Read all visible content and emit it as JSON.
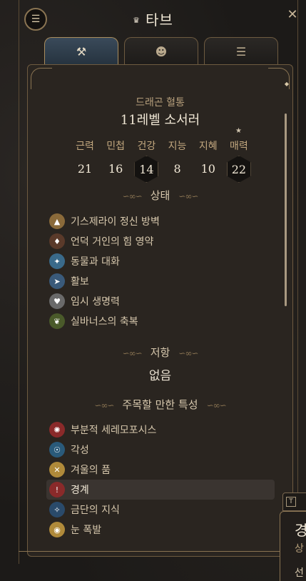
{
  "header": {
    "title": "타브",
    "crown_icon": "crown-icon",
    "menu_icon": "menu-icon",
    "close_label": "✕"
  },
  "tabs": [
    {
      "name": "equipment",
      "icon": "crossed-weapons-icon",
      "active": true
    },
    {
      "name": "character",
      "icon": "head-icon",
      "active": false
    },
    {
      "name": "details",
      "icon": "list-icon",
      "active": false
    }
  ],
  "character": {
    "race": "드래곤 혈통",
    "class_line": "11레벨 소서러"
  },
  "stats": [
    {
      "label": "근력",
      "value": "21",
      "highlight": false
    },
    {
      "label": "민첩",
      "value": "16",
      "highlight": false
    },
    {
      "label": "건강",
      "value": "14",
      "highlight": true
    },
    {
      "label": "지능",
      "value": "8",
      "highlight": false
    },
    {
      "label": "지혜",
      "value": "10",
      "highlight": false
    },
    {
      "label": "매력",
      "value": "22",
      "highlight": true,
      "starred": true
    }
  ],
  "conditions": {
    "heading": "상태",
    "items": [
      {
        "label": "기스제라이 정신 방벽",
        "icon": "mind-barrier-icon",
        "color": "#8a6a3a"
      },
      {
        "label": "언덕 거인의 힘 영약",
        "icon": "potion-icon",
        "color": "#5a3a2a"
      },
      {
        "label": "동물과 대화",
        "icon": "animal-icon",
        "color": "#3a6a8a"
      },
      {
        "label": "활보",
        "icon": "longstrider-icon",
        "color": "#3a5a7a"
      },
      {
        "label": "임시 생명력",
        "icon": "heart-hourglass-icon",
        "color": "#6a6a6a"
      },
      {
        "label": "실바너스의 축복",
        "icon": "leaf-icon",
        "color": "#4a5a2a"
      }
    ]
  },
  "resistances": {
    "heading": "저항",
    "value": "없음"
  },
  "features": {
    "heading": "주목할 만한 특성",
    "items": [
      {
        "label": "부분적 세레모포시스",
        "icon": "ceremorphosis-icon",
        "color": "#8a2a2a",
        "active": false
      },
      {
        "label": "각성",
        "icon": "awakened-icon",
        "color": "#2a5a7a",
        "active": false
      },
      {
        "label": "겨울의 품",
        "icon": "winter-embrace-icon",
        "color": "#b08a3a",
        "active": false
      },
      {
        "label": "경계",
        "icon": "alert-icon",
        "color": "#8a2a2a",
        "active": true
      },
      {
        "label": "금단의 지식",
        "icon": "forbidden-knowledge-icon",
        "color": "#2a4a6a",
        "active": false
      },
      {
        "label": "눈 폭발",
        "icon": "eye-burst-icon",
        "color": "#b08a3a",
        "active": false
      }
    ]
  },
  "tooltip": {
    "key": "T",
    "title": "경",
    "subtitle": "상",
    "more": "선"
  }
}
